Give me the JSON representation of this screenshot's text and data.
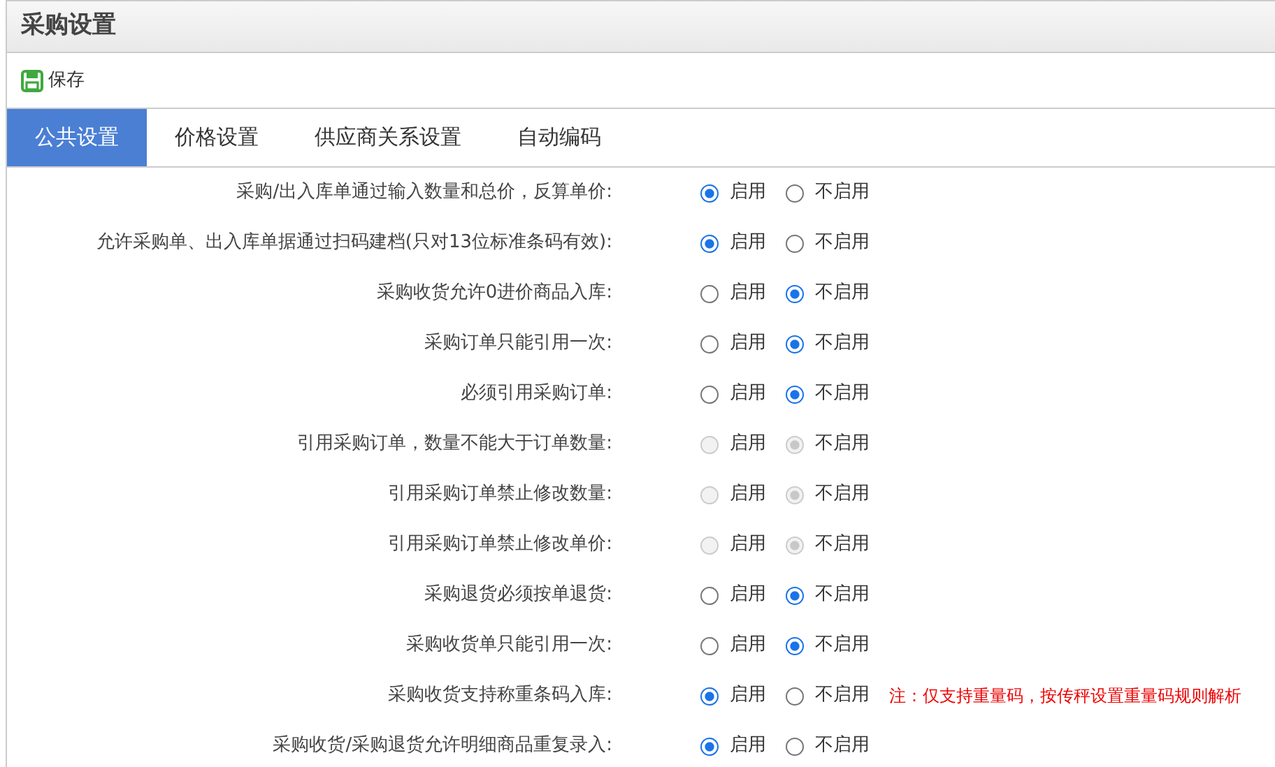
{
  "title": "采购设置",
  "toolbar": [
    {
      "label": "保存"
    }
  ],
  "tabs": [
    {
      "label": "公共设置",
      "selected": true
    },
    {
      "label": "价格设置",
      "selected": false
    },
    {
      "label": "供应商关系设置",
      "selected": false
    },
    {
      "label": "自动编码",
      "selected": false
    }
  ],
  "settings": [
    {
      "label": "采购/出入库单通过输入数量和总价，反算单价:",
      "disabled": false,
      "options": [
        {
          "label": "启用",
          "selected": true
        },
        {
          "label": "不启用",
          "selected": false
        }
      ]
    },
    {
      "label": "允许采购单、出入库单据通过扫码建档(只对13位标准条码有效):",
      "disabled": false,
      "options": [
        {
          "label": "启用",
          "selected": true
        },
        {
          "label": "不启用",
          "selected": false
        }
      ]
    },
    {
      "label": "采购收货允许0进价商品入库:",
      "disabled": false,
      "options": [
        {
          "label": "启用",
          "selected": false
        },
        {
          "label": "不启用",
          "selected": true
        }
      ]
    },
    {
      "label": "采购订单只能引用一次:",
      "disabled": false,
      "options": [
        {
          "label": "启用",
          "selected": false
        },
        {
          "label": "不启用",
          "selected": true
        }
      ]
    },
    {
      "label": "必须引用采购订单:",
      "disabled": false,
      "options": [
        {
          "label": "启用",
          "selected": false
        },
        {
          "label": "不启用",
          "selected": true
        }
      ]
    },
    {
      "label": "引用采购订单，数量不能大于订单数量:",
      "disabled": true,
      "options": [
        {
          "label": "启用",
          "selected": false
        },
        {
          "label": "不启用",
          "selected": true
        }
      ]
    },
    {
      "label": "引用采购订单禁止修改数量:",
      "disabled": true,
      "options": [
        {
          "label": "启用",
          "selected": false
        },
        {
          "label": "不启用",
          "selected": true
        }
      ]
    },
    {
      "label": "引用采购订单禁止修改单价:",
      "disabled": true,
      "options": [
        {
          "label": "启用",
          "selected": false
        },
        {
          "label": "不启用",
          "selected": true
        }
      ]
    },
    {
      "label": "采购退货必须按单退货:",
      "disabled": false,
      "options": [
        {
          "label": "启用",
          "selected": false
        },
        {
          "label": "不启用",
          "selected": true
        }
      ]
    },
    {
      "label": "采购收货单只能引用一次:",
      "disabled": false,
      "options": [
        {
          "label": "启用",
          "selected": false
        },
        {
          "label": "不启用",
          "selected": true
        }
      ]
    },
    {
      "label": "采购收货支持称重条码入库:",
      "disabled": false,
      "options": [
        {
          "label": "启用",
          "selected": true
        },
        {
          "label": "不启用",
          "selected": false
        }
      ],
      "note": "注：仅支持重量码，按传秤设置重量码规则解析"
    },
    {
      "label": "采购收货/采购退货允许明细商品重复录入:",
      "disabled": false,
      "options": [
        {
          "label": "启用",
          "selected": true
        },
        {
          "label": "不启用",
          "selected": false
        }
      ]
    }
  ]
}
